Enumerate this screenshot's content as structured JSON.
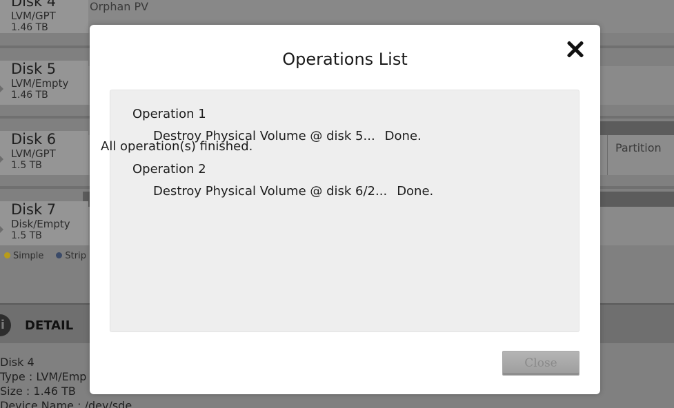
{
  "background": {
    "disks": [
      {
        "name": "Disk 4",
        "type": "LVM/GPT",
        "size": "1.46 TB"
      },
      {
        "name": "Disk 5",
        "type": "LVM/Empty",
        "size": "1.46 TB"
      },
      {
        "name": "Disk 6",
        "type": "LVM/GPT",
        "size": "1.5 TB"
      },
      {
        "name": "Disk 7",
        "type": "Disk/Empty",
        "size": "1.5 TB"
      }
    ],
    "orphan_label": "Orphan PV",
    "partition_label": "Partition",
    "legend": [
      {
        "label": "Simple",
        "color": "#b89c1a"
      },
      {
        "label": "Strip",
        "color": "#3a4a68"
      }
    ],
    "detail": {
      "title": "DETAIL",
      "icon": "info-icon",
      "lines": [
        "Disk 4",
        "Type : LVM/Emp",
        "Size : 1.46 TB",
        "Device Name : /dev/sde"
      ]
    }
  },
  "modal": {
    "title": "Operations List",
    "close_icon": "close-icon",
    "operations": [
      {
        "title": "Operation 1",
        "detail": "Destroy Physical Volume @ disk 5...",
        "status": "Done."
      },
      {
        "title": "Operation 2",
        "detail": "Destroy Physical Volume @ disk 6/2...",
        "status": "Done."
      }
    ],
    "summary": "All operation(s) finished.",
    "close_button_label": "Close"
  }
}
